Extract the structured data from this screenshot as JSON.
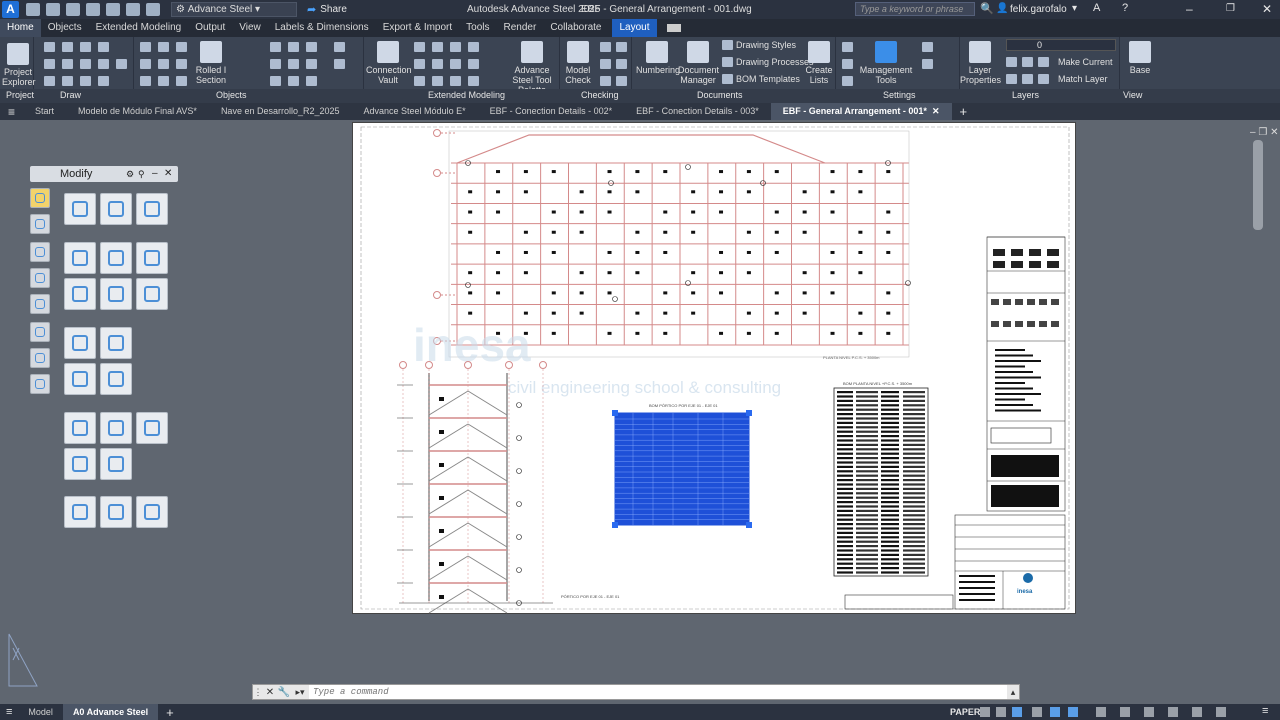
{
  "titlebar": {
    "logo": "A",
    "workspace": "Advance Steel",
    "share": "Share",
    "app_title": "Autodesk Advance Steel 2025",
    "file_title": "EBF - General Arrangement - 001.dwg",
    "search_placeholder": "Type a keyword or phrase",
    "user": "felix.garofalo"
  },
  "menu": [
    "Home",
    "Objects",
    "Extended Modeling",
    "Output",
    "View",
    "Labels & Dimensions",
    "Export & Import",
    "Tools",
    "Render",
    "Collaborate",
    "Layout"
  ],
  "ribbon": {
    "panels": [
      "Project",
      "Draw",
      "Objects",
      "Extended Modeling",
      "Checking",
      "Documents",
      "Settings",
      "Layers",
      "View"
    ],
    "buttons": {
      "project_explorer": "Project Explorer",
      "rolled_section": "Rolled I Section",
      "connection_vault": "Connection Vault",
      "tool_palette": "Advance Steel Tool Palette",
      "model_check": "Model Check",
      "numbering": "Numbering",
      "document_manager": "Document Manager",
      "drawing_styles": "Drawing Styles",
      "drawing_processes": "Drawing Processes",
      "bom_templates": "BOM Templates",
      "create_lists": "Create Lists",
      "management_tools": "Management Tools",
      "layer_properties": "Layer Properties",
      "make_current": "Make Current",
      "match_layer": "Match Layer",
      "base": "Base",
      "layer_value": "0"
    }
  },
  "doc_tabs": [
    "Start",
    "Modelo de Módulo Final AVS*",
    "Nave en Desarrollo_R2_2025",
    "Advance Steel Módulo E*",
    "EBF - Conection Details - 002*",
    "EBF - Conection Details - 003*",
    "EBF - General Arrangement - 001*"
  ],
  "modify_palette": {
    "title": "Modify"
  },
  "drawing": {
    "watermark_line1": "inesa",
    "watermark_line2": "civil engineering school & consulting",
    "plan_title": "PLANTA NIVEL P.C.S. + 3500m",
    "bom_title_left": "BOM PÓRTICO POR EJE 01 - EJE 01",
    "bom_title_right": "BOM PLANTA NIVEL +P.C.S. + 3500m",
    "elev_title": "PÓRTICO POR EJE 01 - EJE 01",
    "titleblock_logo": "inesa"
  },
  "command": {
    "placeholder": "Type a command"
  },
  "status": {
    "tabs": [
      "Model",
      "A0 Advance Steel"
    ],
    "paper": "PAPER"
  },
  "colors": {
    "layout_tab": "#1f5fbf",
    "selection": "#1e50d8",
    "grid_red": "#d48a8a"
  }
}
